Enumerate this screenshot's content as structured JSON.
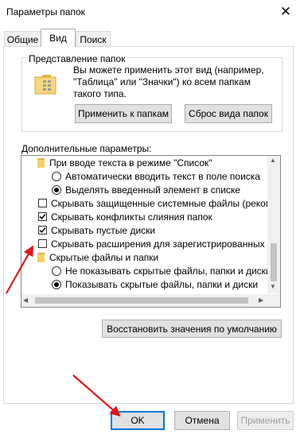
{
  "window": {
    "title": "Параметры папок",
    "close_glyph": "✕"
  },
  "tabs": [
    {
      "label": "Общие"
    },
    {
      "label": "Вид",
      "active": true
    },
    {
      "label": "Поиск"
    }
  ],
  "folder_view": {
    "group_title": "Представление папок",
    "description": "Вы можете применить этот вид (например, \"Таблица\" или \"Значки\") ко всем папкам такого типа.",
    "apply_button": "Применить к папкам",
    "reset_button": "Сброс вида папок"
  },
  "advanced": {
    "label": "Дополнительные параметры:",
    "items": [
      {
        "kind": "folder",
        "label": "При вводе текста в режиме \"Список\""
      },
      {
        "kind": "radio",
        "checked": false,
        "label": "Автоматически вводить текст в поле поиска"
      },
      {
        "kind": "radio",
        "checked": true,
        "label": "Выделять введенный элемент в списке"
      },
      {
        "kind": "checkbox",
        "checked": false,
        "label": "Скрывать защищенные системные файлы (рекомен..."
      },
      {
        "kind": "checkbox",
        "checked": true,
        "label": "Скрывать конфликты слияния папок"
      },
      {
        "kind": "checkbox",
        "checked": true,
        "label": "Скрывать пустые диски"
      },
      {
        "kind": "checkbox",
        "checked": false,
        "label": "Скрывать расширения для зарегистрированных типо"
      },
      {
        "kind": "folder",
        "label": "Скрытые файлы и папки"
      },
      {
        "kind": "radio",
        "checked": false,
        "label": "Не показывать скрытые файлы, папки и диски"
      },
      {
        "kind": "radio",
        "checked": true,
        "label": "Показывать скрытые файлы, папки и диски"
      }
    ]
  },
  "restore_button": "Восстановить значения по умолчанию",
  "footer": {
    "ok": "OK",
    "cancel": "Отмена",
    "apply": "Применить"
  },
  "icons": {
    "scroll_up": "▲",
    "scroll_down": "▼",
    "scroll_left": "◀",
    "scroll_right": "▶"
  },
  "colors": {
    "annotation_arrow": "#e0161b",
    "focus_border": "#0078d7"
  }
}
